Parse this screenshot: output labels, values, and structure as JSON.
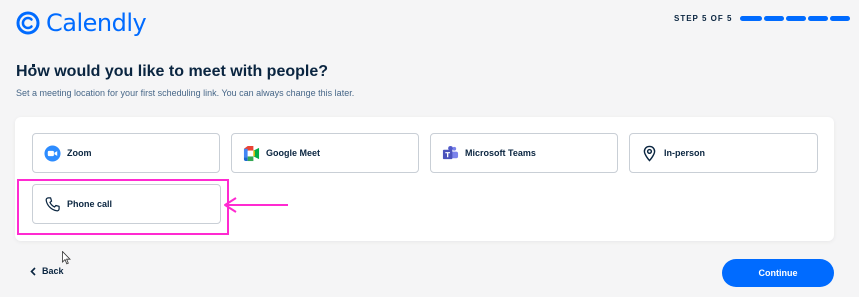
{
  "header": {
    "logo_text": "Calendly",
    "step_label": "STEP 5 OF 5",
    "progress_segments": 5,
    "progress_filled": 5
  },
  "main": {
    "title": "How would you like to meet with people?",
    "subtitle": "Set a meeting location for your first scheduling link. You can always change this later.",
    "options": [
      {
        "label": "Zoom",
        "icon": "zoom-icon"
      },
      {
        "label": "Google Meet",
        "icon": "google-meet-icon"
      },
      {
        "label": "Microsoft Teams",
        "icon": "microsoft-teams-icon"
      },
      {
        "label": "In-person",
        "icon": "location-pin-icon"
      },
      {
        "label": "Phone call",
        "icon": "phone-icon"
      }
    ]
  },
  "footer": {
    "back_label": "Back",
    "continue_label": "Continue"
  },
  "colors": {
    "brand": "#006bff",
    "annotation": "#ff2ad1",
    "text": "#0a2540"
  }
}
